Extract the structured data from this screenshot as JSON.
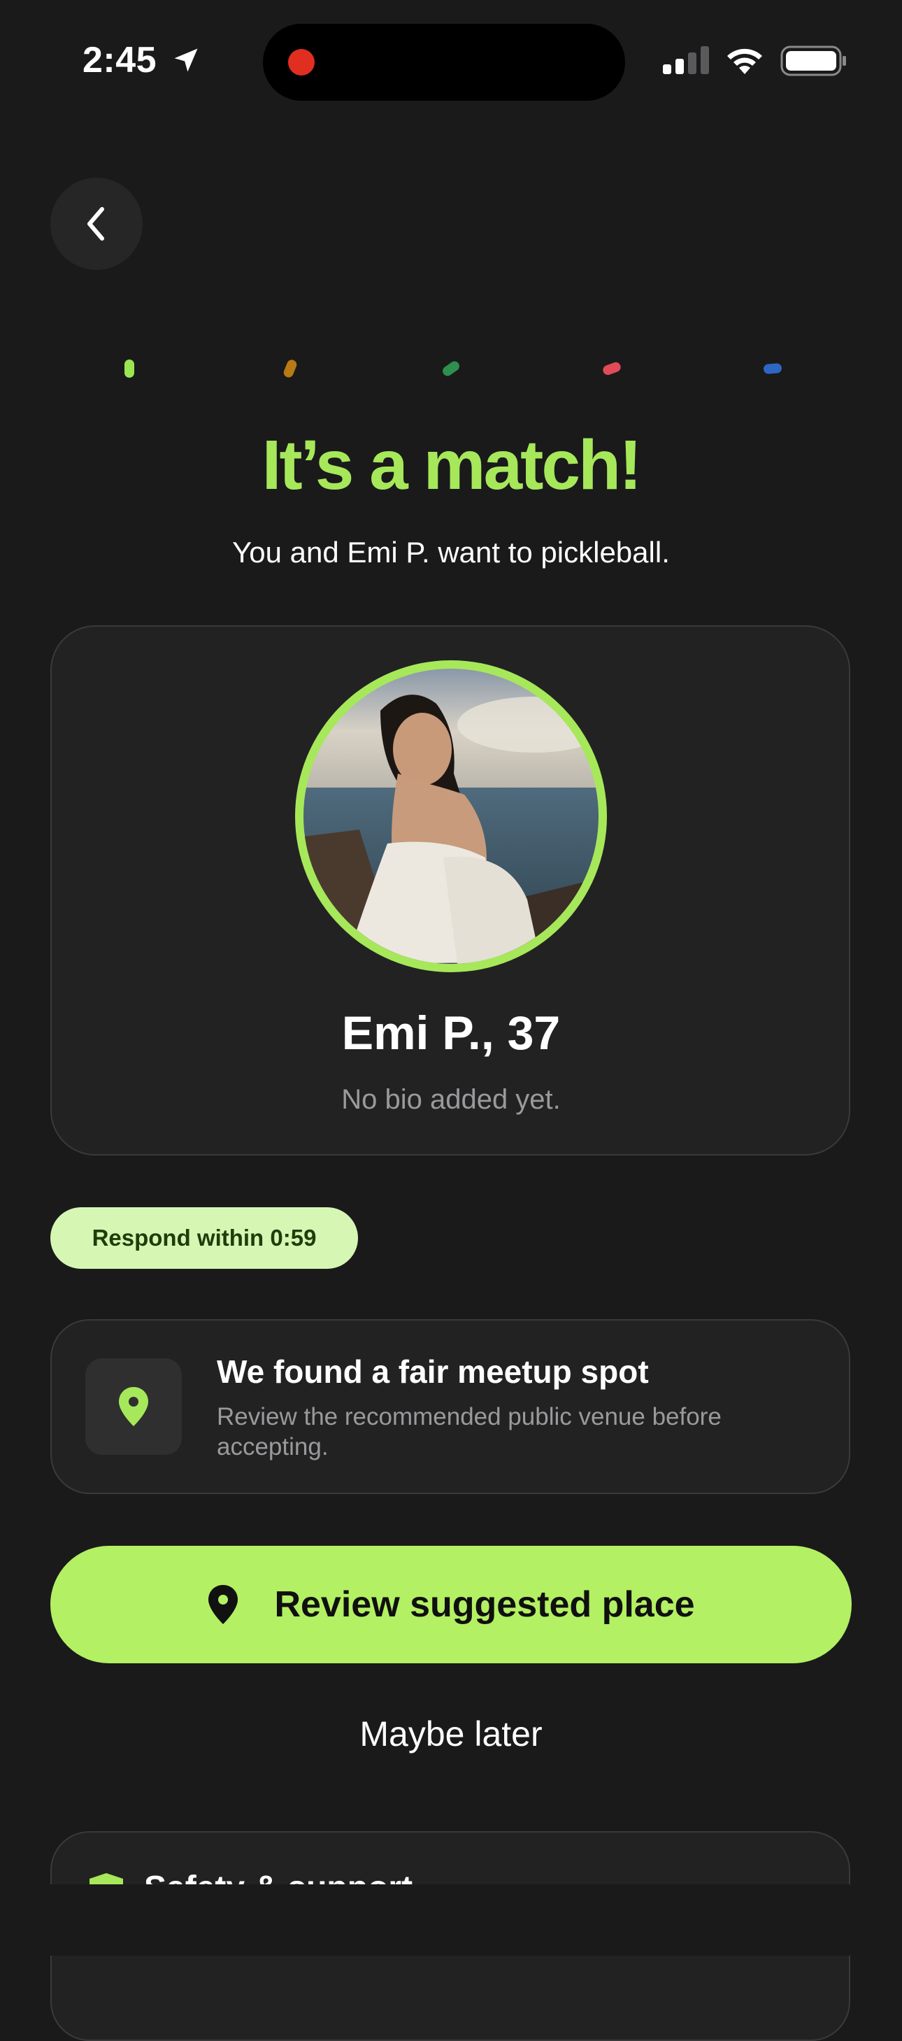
{
  "status_bar": {
    "time": "2:45",
    "icons": [
      "location-arrow-icon",
      "signal-icon",
      "wifi-icon",
      "battery-icon"
    ],
    "recording_indicator_color": "#e02f21"
  },
  "nav": {
    "back_icon": "chevron-left-icon"
  },
  "confetti_colors": [
    "#9ae552",
    "#b87a14",
    "#2f8f4e",
    "#e04b5a",
    "#2f66c4"
  ],
  "match": {
    "headline": "It’s a match!",
    "subline": "You and Emi P. want to pickleball."
  },
  "profile": {
    "name_age": "Emi P., 37",
    "bio": "No bio added yet.",
    "ring_color": "#a6e85a"
  },
  "timer": {
    "label": "Respond within 0:59"
  },
  "meetup": {
    "icon": "map-pin-icon",
    "title": "We found a fair meetup spot",
    "description": "Review the recommended public venue before accepting."
  },
  "actions": {
    "primary_label": "Review suggested place",
    "primary_icon": "map-pin-icon",
    "secondary_label": "Maybe later"
  },
  "safety": {
    "icon": "shield-icon",
    "label": "Safety & support"
  },
  "colors": {
    "accent": "#a6e85a",
    "button": "#b3f063",
    "background": "#1a1a1b",
    "card": "#222223"
  }
}
